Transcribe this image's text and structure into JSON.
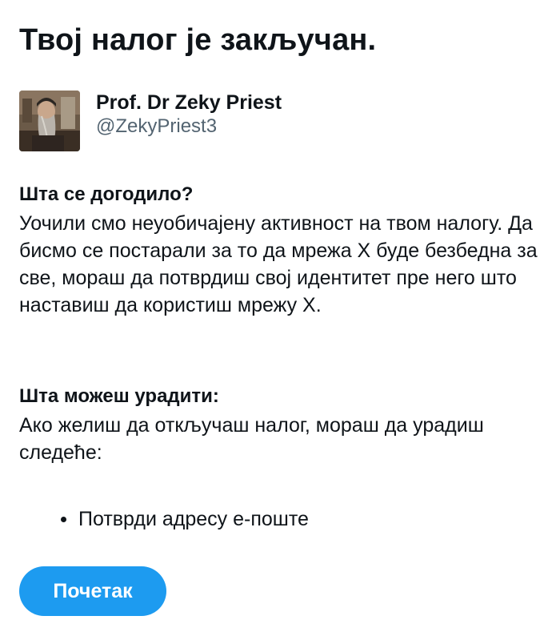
{
  "title": "Твој налог је закључан.",
  "account": {
    "display_name": "Prof. Dr Zeky Priest",
    "handle": "@ZekyPriest3"
  },
  "what_happened": {
    "heading": "Шта се догодило?",
    "body": "Уочили смо неуобичајену активност на твом налогу. Да бисмо се постарали за то да мрежа X буде безбедна за све, мораш да потврдиш свој идентитет пре него што наставиш да користиш мрежу X."
  },
  "what_to_do": {
    "heading": "Шта можеш урадити:",
    "body": "Ако желиш да откључаш налог, мораш да урадиш следеће:",
    "steps": [
      {
        "label": "Потврди адресу е-поште"
      }
    ]
  },
  "start_button": {
    "label": "Почетак"
  },
  "colors": {
    "accent": "#1d9bf0",
    "text_primary": "#0f1419",
    "text_secondary": "#536471",
    "background": "#ffffff"
  }
}
